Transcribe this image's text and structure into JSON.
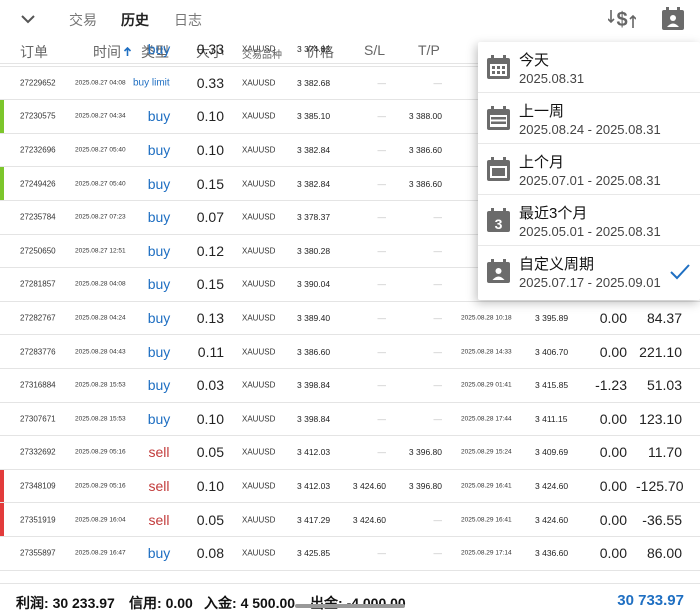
{
  "header": {
    "tabs": [
      {
        "label": "交易",
        "active": false
      },
      {
        "label": "历史",
        "active": true
      },
      {
        "label": "日志",
        "active": false
      }
    ],
    "icons": [
      "chevron-down-icon",
      "dollar-sort-icon",
      "calendar-person-icon"
    ]
  },
  "columns": [
    "订单",
    "时间",
    "类型",
    "大小",
    "交易品种",
    "价格",
    "S/L",
    "T/P"
  ],
  "rows": [
    {
      "id": "",
      "time": "",
      "type": "buy",
      "volume": "0.33",
      "symbol": "XAUUSD",
      "price": "3 374.82",
      "sl": "",
      "tp": "",
      "close_time": "",
      "close_price": "",
      "swap": "",
      "profit": "",
      "bar": ""
    },
    {
      "id": "27229652",
      "time": "2025.08.27 04:08",
      "type": "buy limit",
      "volume": "0.33",
      "symbol": "XAUUSD",
      "price": "3 382.68",
      "sl": "—",
      "tp": "—",
      "close_time": "",
      "close_price": "",
      "swap": "",
      "profit": "",
      "bar": ""
    },
    {
      "id": "27230575",
      "time": "2025.08.27 04:34",
      "type": "buy",
      "volume": "0.10",
      "symbol": "XAUUSD",
      "price": "3 385.10",
      "sl": "—",
      "tp": "3 388.00",
      "close_time": "",
      "close_price": "",
      "swap": "",
      "profit": "",
      "bar": "#7cc62b"
    },
    {
      "id": "27232696",
      "time": "2025.08.27 05:40",
      "type": "buy",
      "volume": "0.10",
      "symbol": "XAUUSD",
      "price": "3 382.84",
      "sl": "—",
      "tp": "3 386.60",
      "close_time": "",
      "close_price": "",
      "swap": "",
      "profit": "",
      "bar": ""
    },
    {
      "id": "27249426",
      "time": "2025.08.27 05:40",
      "type": "buy",
      "volume": "0.15",
      "symbol": "XAUUSD",
      "price": "3 382.84",
      "sl": "—",
      "tp": "3 386.60",
      "close_time": "",
      "close_price": "",
      "swap": "",
      "profit": "",
      "bar": "#7cc62b"
    },
    {
      "id": "27235784",
      "time": "2025.08.27 07:23",
      "type": "buy",
      "volume": "0.07",
      "symbol": "XAUUSD",
      "price": "3 378.37",
      "sl": "—",
      "tp": "—",
      "close_time": "",
      "close_price": "",
      "swap": "",
      "profit": "",
      "bar": ""
    },
    {
      "id": "27250650",
      "time": "2025.08.27 12:51",
      "type": "buy",
      "volume": "0.12",
      "symbol": "XAUUSD",
      "price": "3 380.28",
      "sl": "—",
      "tp": "—",
      "close_time": "",
      "close_price": "",
      "swap": "",
      "profit": "",
      "bar": ""
    },
    {
      "id": "27281857",
      "time": "2025.08.28 04:08",
      "type": "buy",
      "volume": "0.15",
      "symbol": "XAUUSD",
      "price": "3 390.04",
      "sl": "—",
      "tp": "—",
      "close_time": "",
      "close_price": "",
      "swap": "",
      "profit": "",
      "bar": ""
    },
    {
      "id": "27282767",
      "time": "2025.08.28 04:24",
      "type": "buy",
      "volume": "0.13",
      "symbol": "XAUUSD",
      "price": "3 389.40",
      "sl": "—",
      "tp": "—",
      "close_time": "2025.08.28 10:18",
      "close_price": "3 395.89",
      "swap": "0.00",
      "profit": "84.37",
      "bar": ""
    },
    {
      "id": "27283776",
      "time": "2025.08.28 04:43",
      "type": "buy",
      "volume": "0.11",
      "symbol": "XAUUSD",
      "price": "3 386.60",
      "sl": "—",
      "tp": "—",
      "close_time": "2025.08.28 14:33",
      "close_price": "3 406.70",
      "swap": "0.00",
      "profit": "221.10",
      "bar": ""
    },
    {
      "id": "27316884",
      "time": "2025.08.28 15:53",
      "type": "buy",
      "volume": "0.03",
      "symbol": "XAUUSD",
      "price": "3 398.84",
      "sl": "—",
      "tp": "—",
      "close_time": "2025.08.29 01:41",
      "close_price": "3 415.85",
      "swap": "-1.23",
      "profit": "51.03",
      "bar": ""
    },
    {
      "id": "27307671",
      "time": "2025.08.28 15:53",
      "type": "buy",
      "volume": "0.10",
      "symbol": "XAUUSD",
      "price": "3 398.84",
      "sl": "—",
      "tp": "—",
      "close_time": "2025.08.28 17:44",
      "close_price": "3 411.15",
      "swap": "0.00",
      "profit": "123.10",
      "bar": ""
    },
    {
      "id": "27332692",
      "time": "2025.08.29 05:16",
      "type": "sell",
      "volume": "0.05",
      "symbol": "XAUUSD",
      "price": "3 412.03",
      "sl": "—",
      "tp": "3 396.80",
      "close_time": "2025.08.29 15:24",
      "close_price": "3 409.69",
      "swap": "0.00",
      "profit": "11.70",
      "bar": ""
    },
    {
      "id": "27348109",
      "time": "2025.08.29 05:16",
      "type": "sell",
      "volume": "0.10",
      "symbol": "XAUUSD",
      "price": "3 412.03",
      "sl": "3 424.60",
      "tp": "3 396.80",
      "close_time": "2025.08.29 16:41",
      "close_price": "3 424.60",
      "swap": "0.00",
      "profit": "-125.70",
      "bar": "#e23b3b"
    },
    {
      "id": "27351919",
      "time": "2025.08.29 16:04",
      "type": "sell",
      "volume": "0.05",
      "symbol": "XAUUSD",
      "price": "3 417.29",
      "sl": "3 424.60",
      "tp": "—",
      "close_time": "2025.08.29 16:41",
      "close_price": "3 424.60",
      "swap": "0.00",
      "profit": "-36.55",
      "bar": "#e23b3b"
    },
    {
      "id": "27355897",
      "time": "2025.08.29 16:47",
      "type": "buy",
      "volume": "0.08",
      "symbol": "XAUUSD",
      "price": "3 425.85",
      "sl": "—",
      "tp": "—",
      "close_time": "2025.08.29 17:14",
      "close_price": "3 436.60",
      "swap": "0.00",
      "profit": "86.00",
      "bar": ""
    }
  ],
  "footer": {
    "profit_label": "利润:",
    "profit_value": "30 233.97",
    "credit_label": "信用:",
    "credit_value": "0.00",
    "deposit_label": "入金:",
    "deposit_value": "4 500.00",
    "withdraw_label": "出金:",
    "withdraw_value": "-4 000.00",
    "balance": "30 733.97"
  },
  "period_menu": {
    "items": [
      {
        "title": "今天",
        "range": "2025.08.31",
        "icon": "calendar-icon",
        "checked": false
      },
      {
        "title": "上一周",
        "range": "2025.08.24 - 2025.08.31",
        "icon": "calendar-week-icon",
        "checked": false
      },
      {
        "title": "上个月",
        "range": "2025.07.01 - 2025.08.31",
        "icon": "calendar-month-icon",
        "checked": false
      },
      {
        "title": "最近3个月",
        "range": "2025.05.01 - 2025.08.31",
        "icon": "calendar-3-icon",
        "checked": false
      },
      {
        "title": "自定义周期",
        "range": "2025.07.17 - 2025.09.01",
        "icon": "calendar-custom-icon",
        "checked": true
      }
    ]
  },
  "colors": {
    "buy": "#1f6fc2",
    "sell": "#c23b3b",
    "accent": "#1f6fc2",
    "win_bar": "#7cc62b",
    "loss_bar": "#e23b3b"
  }
}
